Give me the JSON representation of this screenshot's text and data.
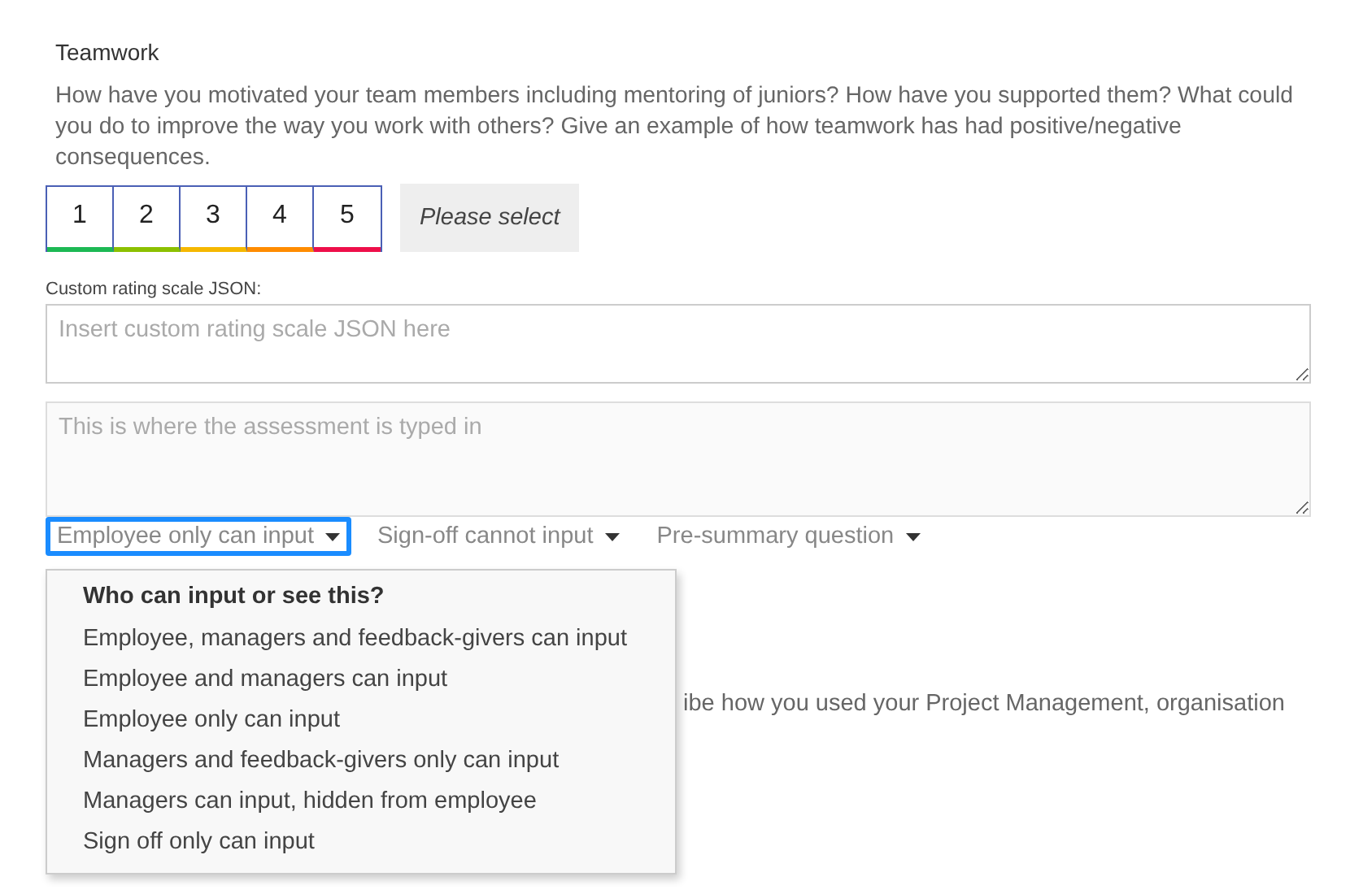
{
  "section": {
    "title": "Teamwork",
    "description": "How have you motivated your team members including mentoring of juniors? How have you supported them? What could you do to improve the way you work with others? Give an example of how teamwork has had positive/negative consequences."
  },
  "rating": [
    {
      "label": "1",
      "color": "#1db954"
    },
    {
      "label": "2",
      "color": "#8cc000"
    },
    {
      "label": "3",
      "color": "#f5b800"
    },
    {
      "label": "4",
      "color": "#ff8c00"
    },
    {
      "label": "5",
      "color": "#ee0f4a"
    }
  ],
  "please_select": "Please select",
  "custom_scale": {
    "label": "Custom rating scale JSON:",
    "placeholder": "Insert custom rating scale JSON here"
  },
  "assessment": {
    "placeholder": "This is where the assessment is typed in"
  },
  "dropdowns": [
    {
      "label": "Employee only can input",
      "expanded": true
    },
    {
      "label": "Sign-off cannot input",
      "expanded": false
    },
    {
      "label": "Pre-summary question",
      "expanded": false
    }
  ],
  "menu": {
    "header": "Who can input or see this?",
    "items": [
      "Employee, managers and feedback-givers can input",
      "Employee and managers can input",
      "Employee only can input",
      "Managers and feedback-givers only can input",
      "Managers can input, hidden from employee",
      "Sign off only can input"
    ]
  },
  "next_question_partial": "ibe how you used your Project Management, organisation"
}
